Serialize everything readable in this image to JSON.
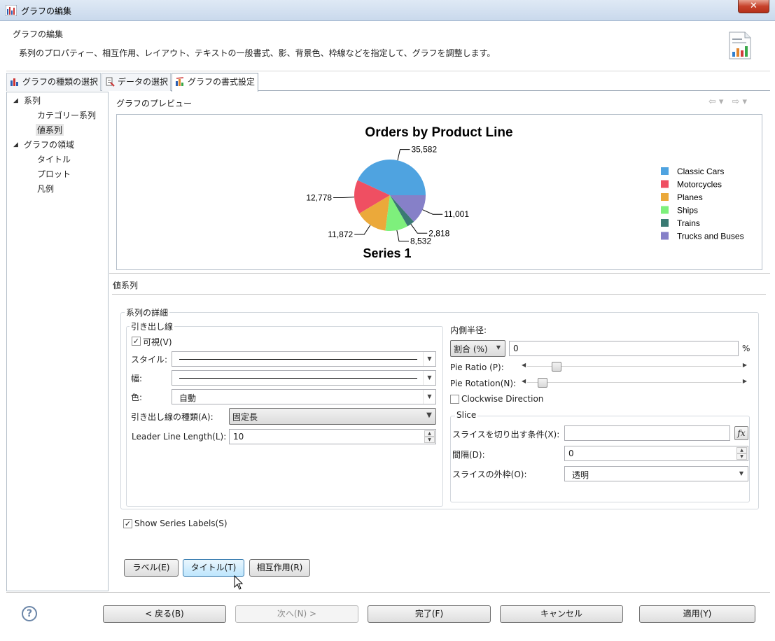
{
  "window": {
    "title": "グラフの編集",
    "close_label": "✕"
  },
  "header": {
    "title": "グラフの編集",
    "description": "系列のプロパティー、相互作用、レイアウト、テキストの一般書式、影、背景色、枠線などを指定して、グラフを調整します。"
  },
  "tabs": [
    {
      "label": "グラフの種類の選択"
    },
    {
      "label": "データの選択"
    },
    {
      "label": "グラフの書式設定",
      "active": true
    }
  ],
  "tree": {
    "items": [
      {
        "label": "系列"
      },
      {
        "label": "カテゴリー系列"
      },
      {
        "label": "値系列"
      },
      {
        "label": "グラフの領域"
      },
      {
        "label": "タイトル"
      },
      {
        "label": "プロット"
      },
      {
        "label": "凡例"
      }
    ]
  },
  "preview": {
    "label": "グラフのプレビュー"
  },
  "chart_data": {
    "type": "pie",
    "title": "Orders by Product Line",
    "series_label": "Series 1",
    "categories": [
      "Classic Cars",
      "Motorcycles",
      "Planes",
      "Ships",
      "Trains",
      "Trucks and Buses"
    ],
    "values": [
      35582,
      12778,
      11872,
      8532,
      2818,
      11001
    ],
    "value_labels": [
      "35,582",
      "12,778",
      "11,872",
      "8,532",
      "2,818",
      "11,001"
    ],
    "colors": [
      "#4fa3e0",
      "#ef4f62",
      "#eba93a",
      "#7ef07c",
      "#3a7a73",
      "#8680c8"
    ],
    "legend_position": "right"
  },
  "section": {
    "label": "値系列"
  },
  "series_details": {
    "group_label": "系列の詳細",
    "leader_group_label": "引き出し線",
    "visible_label": "可視(V)",
    "visible_checked": "✓",
    "style_label": "スタイル:",
    "width_label": "幅:",
    "color_label": "色:",
    "color_value": "自動",
    "leader_type_label": "引き出し線の種類(A):",
    "leader_type_value": "固定長",
    "leader_length_label": "Leader Line Length(L):",
    "leader_length_value": "10",
    "inner_radius_label": "内側半径:",
    "inner_radius_unit_value": "割合 (%)",
    "inner_radius_value": "0",
    "inner_radius_suffix": "%",
    "pie_ratio_label": "Pie Ratio (P):",
    "pie_ratio_position": 0.12,
    "pie_rotation_label": "Pie Rotation(N):",
    "pie_rotation_position": 0.05,
    "clockwise_label": "Clockwise Direction",
    "slice_group_label": "Slice",
    "slice_condition_label": "スライスを切り出す条件(X):",
    "slice_condition_value": "",
    "fx_label": "fx",
    "gap_label": "間隔(D):",
    "gap_value": "0",
    "slice_outline_label": "スライスの外枠(O):",
    "slice_outline_value": "透明",
    "show_series_labels": "Show Series Labels(S)",
    "show_series_checked": "✓"
  },
  "subbuttons": {
    "label": "ラベル(E)",
    "title": "タイトル(T)",
    "interactivity": "相互作用(R)"
  },
  "footer": {
    "help": "?",
    "back": "< 戻る(B)",
    "next": "次へ(N) >",
    "finish": "完了(F)",
    "cancel": "キャンセル",
    "apply": "適用(Y)"
  }
}
